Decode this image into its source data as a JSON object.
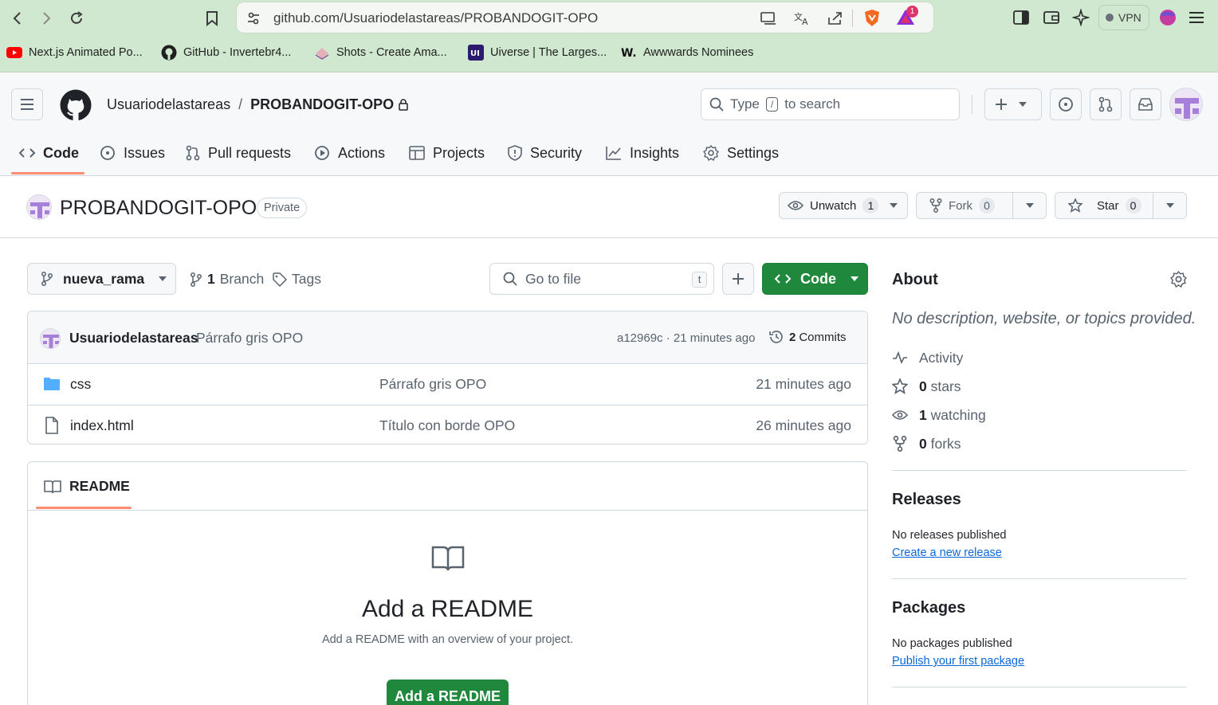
{
  "browser": {
    "url": "github.com/Usuariodelastareas/PROBANDOGIT-OPO",
    "brave_badge": "1",
    "vpn_label": "VPN",
    "bookmarks": [
      {
        "label": "Next.js Animated Po...",
        "icon": "youtube-icon"
      },
      {
        "label": "GitHub - Invertebr4...",
        "icon": "github-icon"
      },
      {
        "label": "Shots - Create Ama...",
        "icon": "shots-icon"
      },
      {
        "label": "Uiverse | The Larges...",
        "icon": "uiverse-icon"
      },
      {
        "label": "Awwwards Nominees",
        "icon": "awwwards-icon"
      }
    ]
  },
  "header": {
    "owner": "Usuariodelastareas",
    "separator": "/",
    "repo": "PROBANDOGIT-OPO",
    "search_prefix": "Type",
    "search_key": "/",
    "search_suffix": "to search"
  },
  "nav": {
    "tabs": [
      {
        "label": "Code",
        "icon": "code-icon"
      },
      {
        "label": "Issues",
        "icon": "issue-icon"
      },
      {
        "label": "Pull requests",
        "icon": "pull-request-icon"
      },
      {
        "label": "Actions",
        "icon": "play-icon"
      },
      {
        "label": "Projects",
        "icon": "table-icon"
      },
      {
        "label": "Security",
        "icon": "shield-icon"
      },
      {
        "label": "Insights",
        "icon": "graph-icon"
      },
      {
        "label": "Settings",
        "icon": "gear-icon"
      }
    ],
    "active": "Code"
  },
  "repo": {
    "name": "PROBANDOGIT-OPO",
    "visibility": "Private",
    "unwatch_label": "Unwatch",
    "watch_count": "1",
    "fork_label": "Fork",
    "fork_count": "0",
    "star_label": "Star",
    "star_count": "0"
  },
  "toolbar": {
    "branch": "nueva_rama",
    "branch_count": "1",
    "branch_label": "Branch",
    "tags_label": "Tags",
    "goto_placeholder": "Go to file",
    "goto_key": "t",
    "code_label": "Code"
  },
  "commit": {
    "author": "Usuariodelastareas",
    "message": "Párrafo gris OPO",
    "sha_time": "a12969c · 21 minutes ago",
    "commits_count": "2",
    "commits_label": "Commits"
  },
  "files": [
    {
      "name": "css",
      "type": "folder",
      "message": "Párrafo gris OPO",
      "time": "21 minutes ago"
    },
    {
      "name": "index.html",
      "type": "file",
      "message": "Título con borde OPO",
      "time": "26 minutes ago"
    }
  ],
  "readme": {
    "tab_label": "README",
    "title": "Add a README",
    "subtitle": "Add a README with an overview of your project.",
    "button_label": "Add a README"
  },
  "about": {
    "heading": "About",
    "description": "No description, website, or topics provided.",
    "activity_label": "Activity",
    "stars_count": "0",
    "stars_label": "stars",
    "watching_count": "1",
    "watching_label": "watching",
    "forks_count": "0",
    "forks_label": "forks"
  },
  "releases": {
    "heading": "Releases",
    "status": "No releases published",
    "link": "Create a new release"
  },
  "packages": {
    "heading": "Packages",
    "status": "No packages published",
    "link": "Publish your first package"
  },
  "colors": {
    "browser_bar": "#cfe8cf",
    "accent_underline": "#fd8c73",
    "primary_green": "#1f883d",
    "link_blue": "#0969da"
  }
}
